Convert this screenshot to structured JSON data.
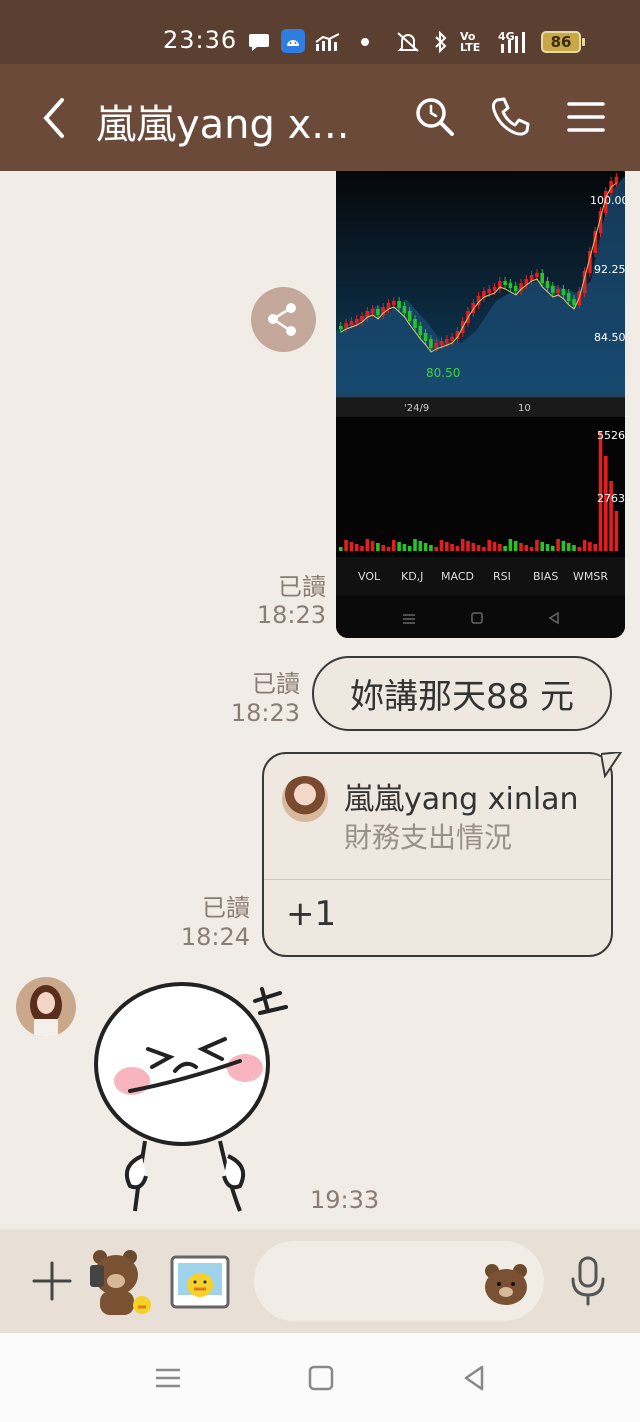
{
  "status_bar": {
    "time": "23:36",
    "battery": "86",
    "network": "4G",
    "volte": "Vo LTE"
  },
  "header": {
    "title": "嵐嵐yang x..."
  },
  "messages": {
    "chart_image": {
      "read": "已讀",
      "time": "18:23",
      "price_labels": [
        "100.00",
        "92.25",
        "84.50"
      ],
      "low_label": "80.50",
      "date_labels": [
        "'24/9",
        "10"
      ],
      "volume_labels": [
        "5526",
        "2763"
      ],
      "indicator_tabs": [
        "VOL",
        "KD,J",
        "MACD",
        "RSI",
        "BIAS",
        "WMSR"
      ]
    },
    "text_bubble": {
      "read": "已讀",
      "time": "18:23",
      "text": "妳講那天88 元"
    },
    "shared_contact": {
      "read": "已讀",
      "time": "18:24",
      "name": "嵐嵐yang xinlan",
      "subtitle": "財務支出情況",
      "reply": "+1"
    },
    "sticker": {
      "time": "19:33"
    }
  },
  "input_bar": {
    "placeholder": ""
  },
  "colors": {
    "header": "#6b4a3a",
    "status_bar": "#5b3f31",
    "chat_bg": "#f1ece5",
    "candle_up": "#e02020",
    "candle_down": "#29c229"
  }
}
